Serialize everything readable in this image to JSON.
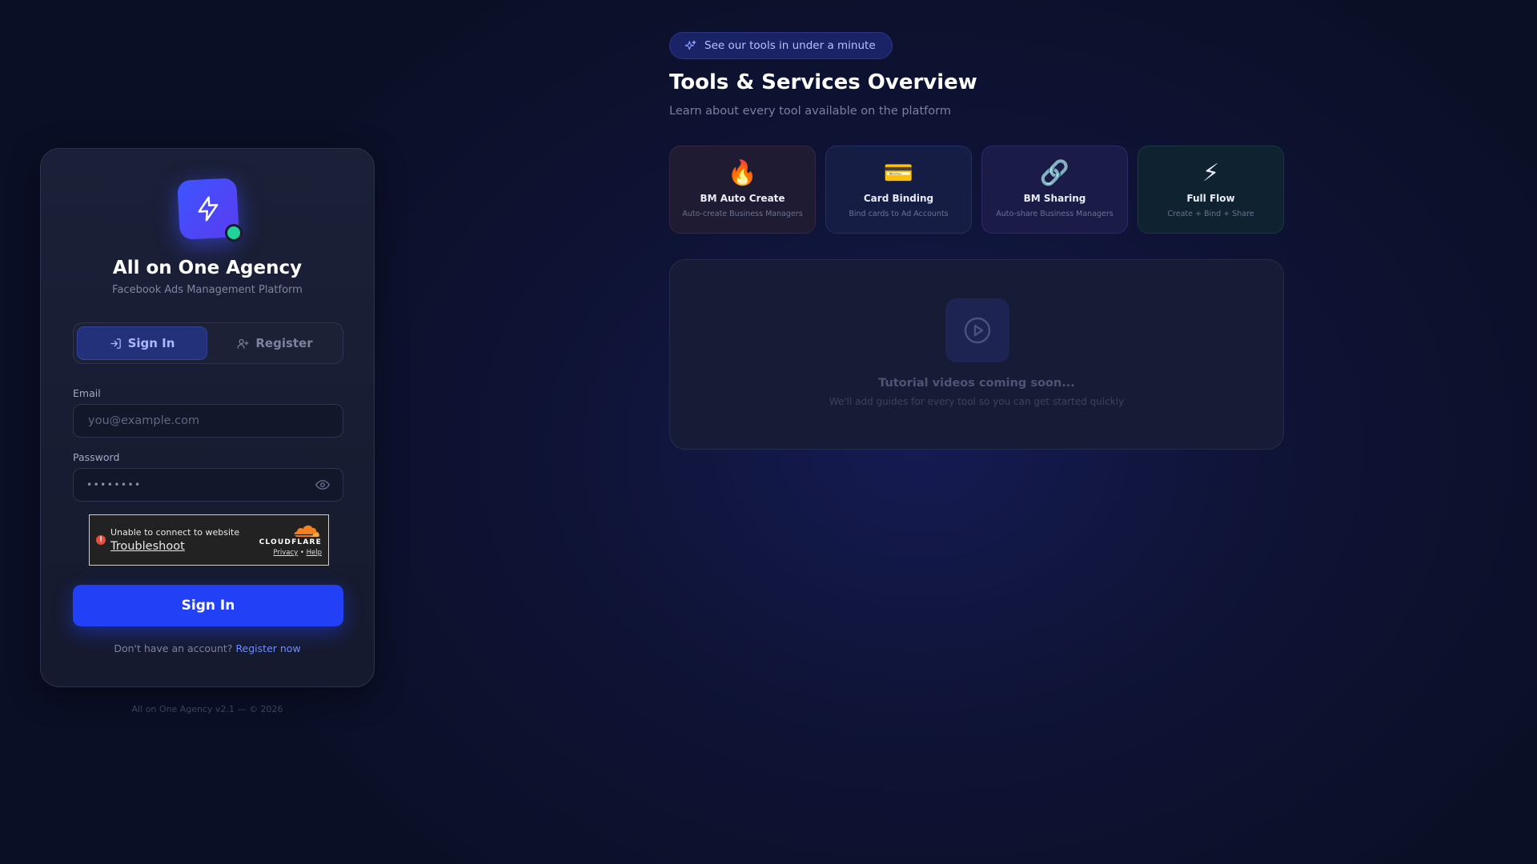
{
  "login": {
    "app_title": "All on One Agency",
    "app_subtitle": "Facebook Ads Management Platform",
    "tabs": [
      {
        "label": "Sign In",
        "icon": "sign-in-icon",
        "active": true
      },
      {
        "label": "Register",
        "icon": "user-plus-icon",
        "active": false
      }
    ],
    "email_label": "Email",
    "email_placeholder": "you@example.com",
    "password_label": "Password",
    "password_value": "••••••••",
    "captcha": {
      "message": "Unable to connect to website",
      "link": "Troubleshoot",
      "brand": "CLOUDFLARE",
      "privacy": "Privacy",
      "separator": "•",
      "help": "Help"
    },
    "submit_label": "Sign In",
    "no_account_text": "Don't have an account?",
    "register_link": "Register now",
    "footer": "All on One Agency v2.1 — © 2026"
  },
  "overview": {
    "pill_label": "See our tools in under a minute",
    "title": "Tools & Services Overview",
    "subtitle": "Learn about every tool available on the platform",
    "tools": [
      {
        "emoji": "🔥",
        "name": "BM Auto Create",
        "desc": "Auto-create Business Managers"
      },
      {
        "emoji": "💳",
        "name": "Card Binding",
        "desc": "Bind cards to Ad Accounts"
      },
      {
        "emoji": "🔗",
        "name": "BM Sharing",
        "desc": "Auto-share Business Managers"
      },
      {
        "emoji": "⚡",
        "name": "Full Flow",
        "desc": "Create + Bind + Share"
      }
    ],
    "video_title": "Tutorial videos coming soon...",
    "video_subtitle": "We'll add guides for every tool so you can get started quickly"
  },
  "colors": {
    "accent": "#2240f5",
    "status_online": "#1fd39a",
    "link": "#6f8dff"
  }
}
